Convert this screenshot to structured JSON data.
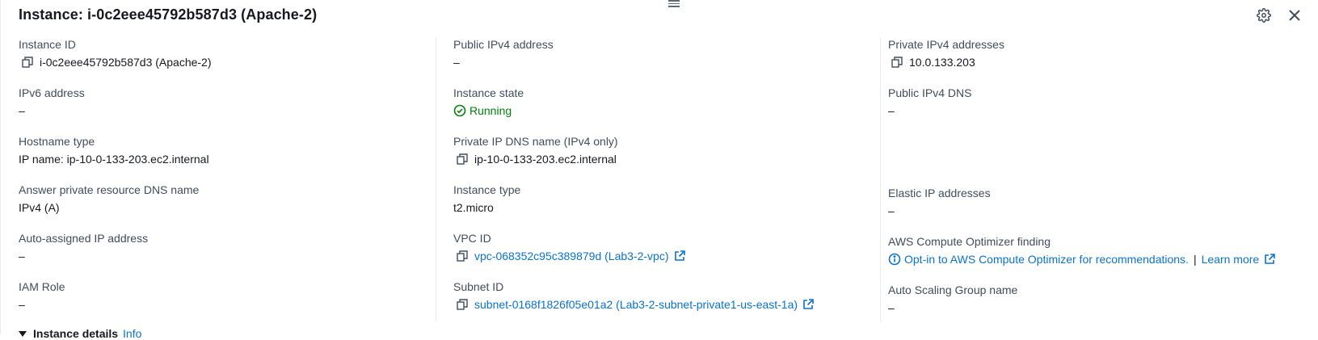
{
  "header": {
    "title": "Instance: i-0c2eee45792b587d3 (Apache-2)",
    "settings_icon": "gear-icon",
    "close_icon": "close-icon"
  },
  "col1": [
    {
      "label": "Instance ID",
      "value": "i-0c2eee45792b587d3 (Apache-2)"
    },
    {
      "label": "IPv6 address",
      "value": "–"
    },
    {
      "label": "Hostname type",
      "value": "IP name: ip-10-0-133-203.ec2.internal"
    },
    {
      "label": "Answer private resource DNS name",
      "value": "IPv4 (A)"
    },
    {
      "label": "Auto-assigned IP address",
      "value": "–"
    },
    {
      "label": "IAM Role",
      "value": "–"
    }
  ],
  "col2": [
    {
      "label": "Public IPv4 address",
      "value": "–"
    },
    {
      "label": "Instance state",
      "value": "Running"
    },
    {
      "label": "Private IP DNS name (IPv4 only)",
      "value": "ip-10-0-133-203.ec2.internal"
    },
    {
      "label": "Instance type",
      "value": "t2.micro"
    },
    {
      "label": "VPC ID",
      "value": "vpc-068352c95c389879d (Lab3-2-vpc)"
    },
    {
      "label": "Subnet ID",
      "value": "subnet-0168f1826f05e01a2 (Lab3-2-subnet-private1-us-east-1a)"
    }
  ],
  "col3": [
    {
      "label": "Private IPv4 addresses",
      "value": "10.0.133.203"
    },
    {
      "label": "Public IPv4 DNS",
      "value": "–"
    },
    {
      "label": "",
      "value": ""
    },
    {
      "label": "Elastic IP addresses",
      "value": "–"
    },
    {
      "label": "AWS Compute Optimizer finding",
      "value": "Opt-in to AWS Compute Optimizer for recommendations.",
      "separator": "|",
      "link2": "Learn more"
    },
    {
      "label": "Auto Scaling Group name",
      "value": "–"
    }
  ],
  "bottom": {
    "section_title": "Instance details",
    "info_link": "Info"
  },
  "colors": {
    "link": "#0972d3",
    "success": "#037f0c",
    "text": "#16191f",
    "label": "#414d5c"
  }
}
